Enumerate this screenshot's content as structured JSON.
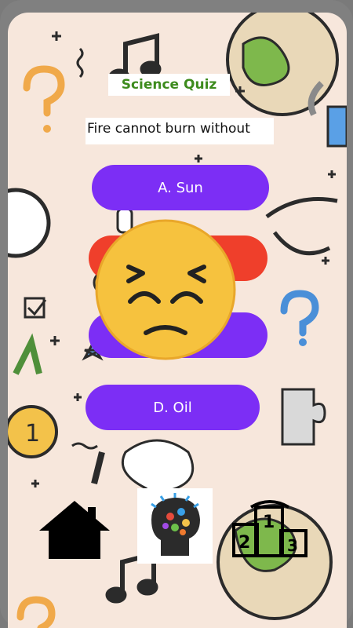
{
  "app": {
    "title": "Science Quiz"
  },
  "question": {
    "text": "Fire cannot burn without"
  },
  "options": [
    {
      "label": "A. Sun",
      "state": "default"
    },
    {
      "label": "",
      "state": "wrong"
    },
    {
      "label": "",
      "state": "default"
    },
    {
      "label": "D. Oil",
      "state": "default"
    }
  ],
  "feedback": {
    "icon": "frustrated-face-icon"
  },
  "bottom_nav": [
    {
      "icon": "home-icon"
    },
    {
      "icon": "brain-icon"
    },
    {
      "icon": "podium-icon",
      "ranks": [
        "1",
        "2",
        "3"
      ]
    }
  ],
  "colors": {
    "option": "#7c2ef5",
    "wrong": "#ef3f2b",
    "title": "#3d8b1d",
    "background": "#f7e7dc"
  }
}
